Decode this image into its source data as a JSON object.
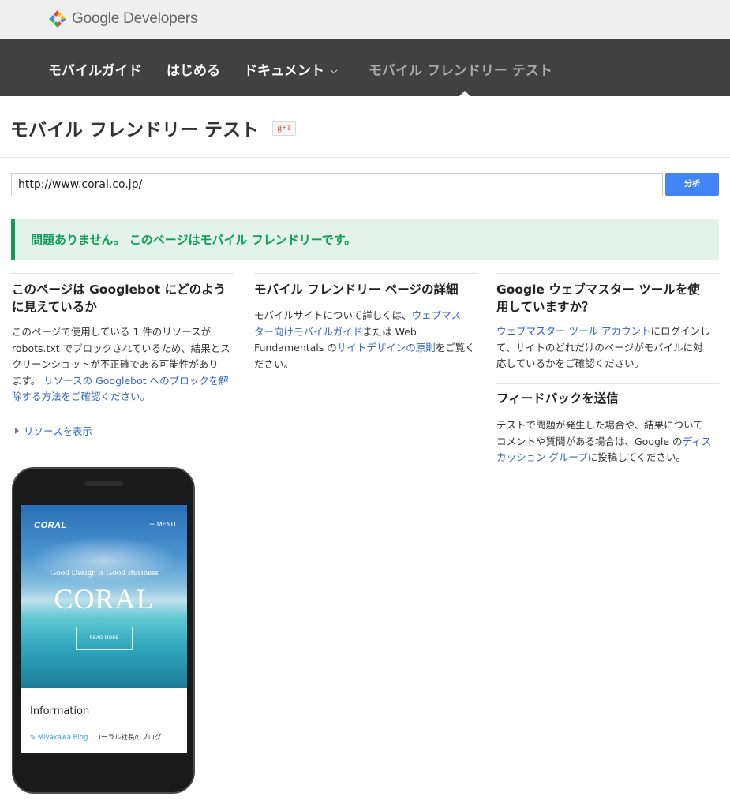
{
  "brand": {
    "logo_text": "Google Developers"
  },
  "nav": {
    "items": [
      {
        "label": "モバイルガイド"
      },
      {
        "label": "はじめる"
      },
      {
        "label": "ドキュメント"
      },
      {
        "label": "モバイル フレンドリー テスト"
      }
    ],
    "dropdown_icon": "chevron-down-icon"
  },
  "page": {
    "title": "モバイル フレンドリー テスト",
    "gplus_label": "g+1"
  },
  "form": {
    "url_value": "http://www.coral.co.jp/",
    "analyze_label": "分析"
  },
  "result": {
    "message": "問題ありません。 このページはモバイル フレンドリーです。"
  },
  "col1": {
    "heading_line1": "このページは Googlebot にどのよう",
    "heading_line2": "に見えているか",
    "p_line1": "このページで使用している 1 件のリソースが",
    "p_line2": "robots.txt でブロックされているため、結果とス",
    "p_line3": "クリーンショットが不正確である可能性があり",
    "p_line4_text": "ます。",
    "p_line4_link": "リソースの Googlebot へのブロックを解",
    "p_line5_link": "除する方法をご確認ください。",
    "resources_link": "リソースを表示"
  },
  "col2": {
    "heading": "モバイル フレンドリー ページの詳細",
    "p_line1_text": "モバイルサイトについて詳しくは、",
    "p_line1_link": "ウェブマス",
    "p_line2_link": "ター向けモバイルガイド",
    "p_line2_text": "または Web",
    "p_line3_text_a": "Fundamentals の",
    "p_line3_link": "サイトデザインの原則",
    "p_line3_text_b": "をご覧く",
    "p_line4_text": "ださい。"
  },
  "col3": {
    "heading_line1": "Google ウェブマスター ツールを使",
    "heading_line2": "用していますか？",
    "p_line1_link": "ウェブマスター ツール アカウント",
    "p_line1_text": "にログインし",
    "p_line2": "て、サイトのどれだけのページがモバイルに対",
    "p_line3": "応しているかをご確認ください。",
    "feedback_heading": "フィードバックを送信",
    "f_line1": "テストで問題が発生した場合や、結果について",
    "f_line2_text": "コメントや質問がある場合は、Google の",
    "f_line2_link": "ディス",
    "f_line3_link": "カッション グループ",
    "f_line3_text": "に投稿してください。"
  },
  "phone_screen": {
    "site_logo": "CORAL",
    "menu_label": "☰ MENU",
    "tagline": "Good Design is Good Business",
    "big_title": "CORAL",
    "read_more": "READ MORE",
    "info_title": "Information",
    "blog_link": "Miyakawa Blog",
    "blog_desc": "コーラル社長のブログ"
  },
  "colors": {
    "nav_bg": "#414141",
    "accent_blue": "#4285f4",
    "success_green": "#0f9d58",
    "link_blue": "#3366bb"
  }
}
